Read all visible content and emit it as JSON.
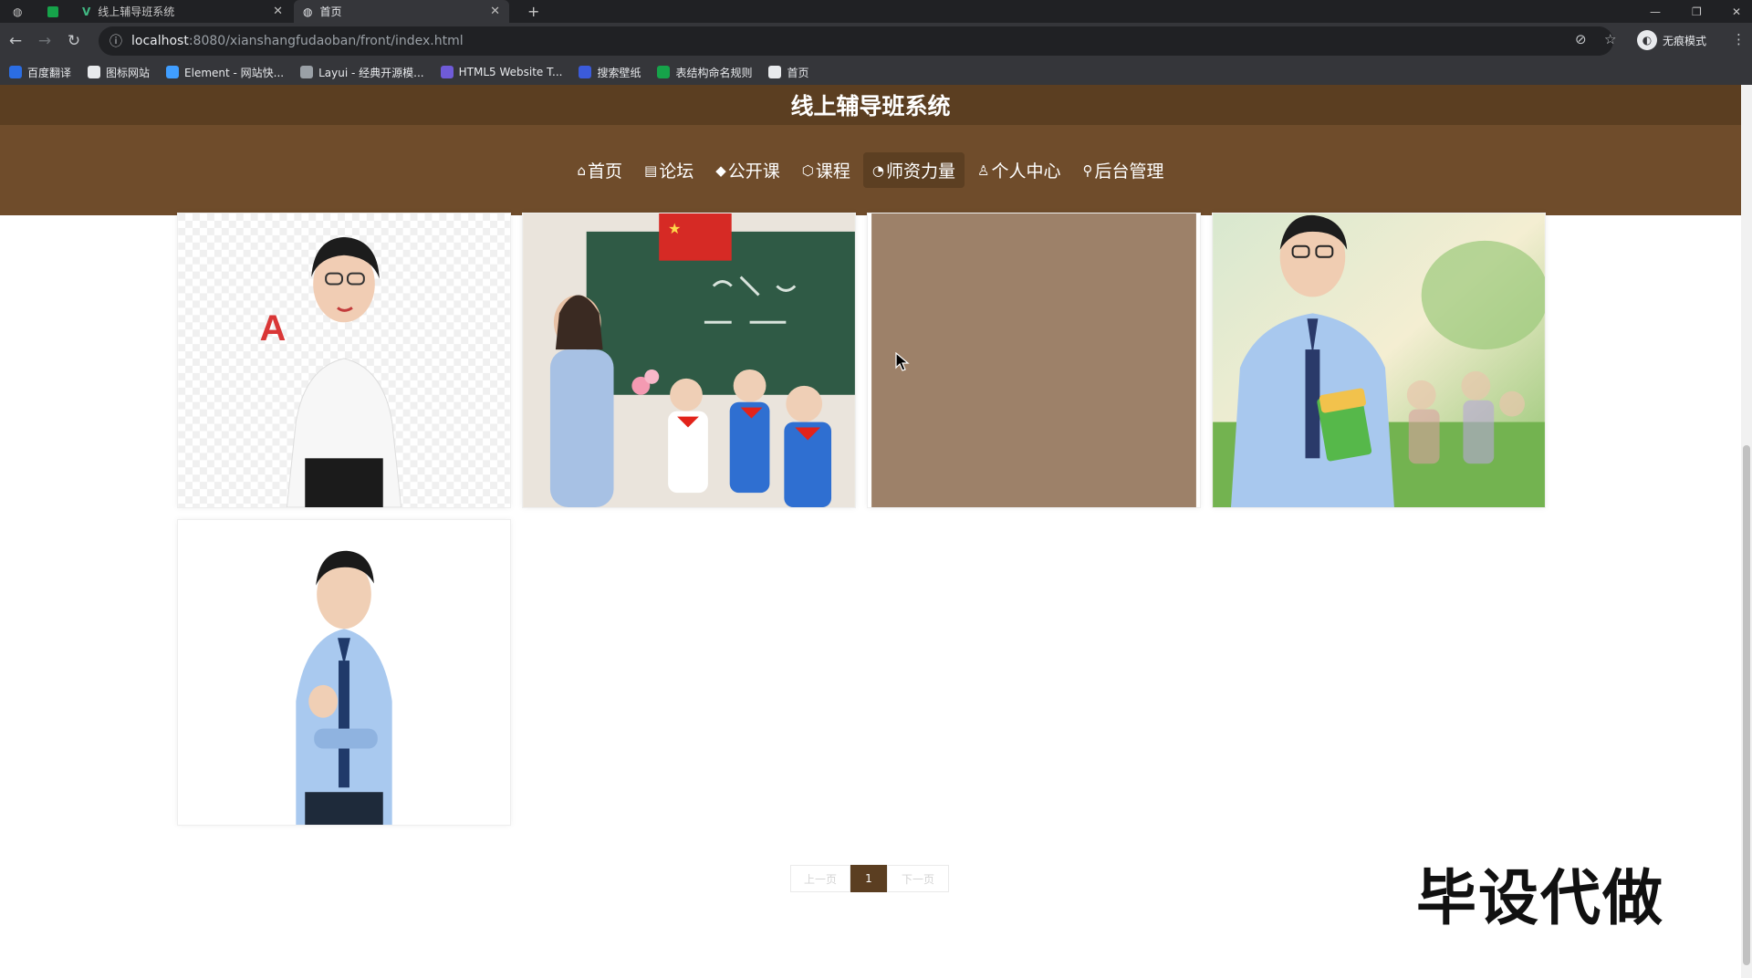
{
  "browser": {
    "tabs": [
      {
        "title": "线上辅导班系统"
      },
      {
        "title": "首页"
      }
    ],
    "new_tab": "+",
    "url_host": "localhost",
    "url_rest": ":8080/xianshangfudaoban/front/index.html",
    "profile_label": "无痕模式",
    "bookmarks": [
      {
        "label": "百度翻译",
        "color": "#2b6de3"
      },
      {
        "label": "图标网站",
        "color": "#e8eaed"
      },
      {
        "label": "Element - 网站快...",
        "color": "#409eff"
      },
      {
        "label": "Layui - 经典开源模...",
        "color": "#9aa0a6"
      },
      {
        "label": "HTML5 Website T...",
        "color": "#6f5bd8"
      },
      {
        "label": "搜索壁纸",
        "color": "#3b5bdb"
      },
      {
        "label": "表结构命名规则",
        "color": "#16a34a"
      },
      {
        "label": "首页",
        "color": "#e8eaed"
      }
    ]
  },
  "site": {
    "title": "线上辅导班系统",
    "nav": [
      {
        "icon": "home-icon",
        "glyph": "⌂",
        "label": "首页"
      },
      {
        "icon": "forum-icon",
        "glyph": "▤",
        "label": "论坛"
      },
      {
        "icon": "graduation-icon",
        "glyph": "◆",
        "label": "公开课"
      },
      {
        "icon": "course-icon",
        "glyph": "⬡",
        "label": "课程"
      },
      {
        "icon": "power-icon",
        "glyph": "◔",
        "label": "师资力量",
        "active": true
      },
      {
        "icon": "user-icon",
        "glyph": "♙",
        "label": "个人中心"
      },
      {
        "icon": "link-icon",
        "glyph": "⚲",
        "label": "后台管理"
      }
    ]
  },
  "teachers": [
    {
      "name": "teacher-photo-1",
      "desc": "female teacher holding letter A"
    },
    {
      "name": "teacher-photo-2",
      "desc": "teacher receiving flowers from students"
    },
    {
      "name": "teacher-photo-3",
      "desc": "placeholder brown image"
    },
    {
      "name": "teacher-photo-4",
      "desc": "male teacher holding books outdoors"
    },
    {
      "name": "teacher-photo-5",
      "desc": "male teacher in blue shirt"
    }
  ],
  "pagination": {
    "prev": "上一页",
    "current": "1",
    "next": "下一页"
  },
  "watermark": "毕设代做",
  "colors": {
    "header": "#5b3e21",
    "nav": "#6f4c2b",
    "placeholder": "#9d8169"
  }
}
